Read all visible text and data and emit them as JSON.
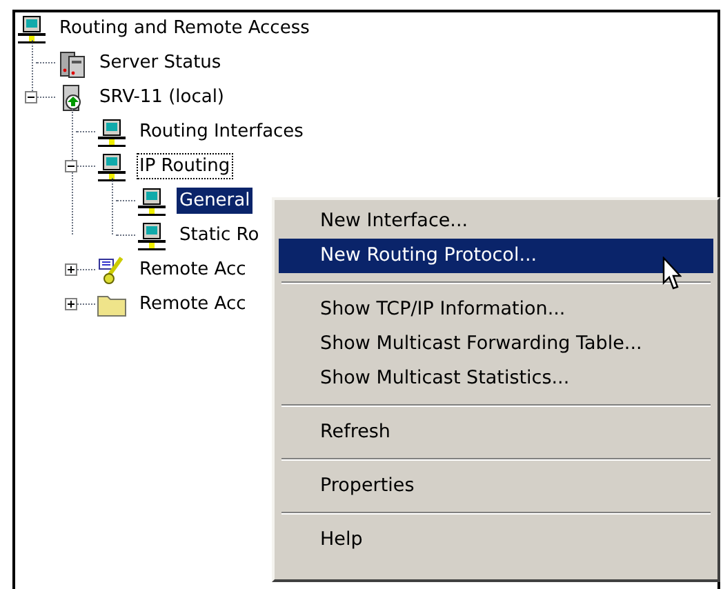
{
  "tree": [
    {
      "label": "Routing and Remote Access",
      "kind": "computer",
      "selected": false,
      "focused": false,
      "children": [
        {
          "label": "Server Status",
          "kind": "server",
          "selected": false,
          "focused": false
        },
        {
          "label": "SRV-11 (local)",
          "kind": "local-server",
          "expanded": true,
          "selected": false,
          "focused": false,
          "children": [
            {
              "label": "Routing Interfaces",
              "kind": "computer",
              "selected": false,
              "focused": false
            },
            {
              "label": "IP Routing",
              "kind": "computer",
              "expanded": true,
              "selected": false,
              "focused": true,
              "children": [
                {
                  "label": "General",
                  "kind": "computer",
                  "selected": true,
                  "focused": false
                },
                {
                  "label": "Static Ro",
                  "kind": "computer",
                  "selected": false,
                  "focused": false
                }
              ]
            },
            {
              "label": "Remote Acc",
              "kind": "policy",
              "expanded": false,
              "selected": false,
              "focused": false
            },
            {
              "label": "Remote Acc",
              "kind": "folder",
              "expanded": false,
              "selected": false,
              "focused": false
            }
          ]
        }
      ]
    }
  ],
  "context_menu": [
    {
      "kind": "item",
      "label": "New Interface...",
      "selected": false
    },
    {
      "kind": "item",
      "label": "New Routing Protocol...",
      "selected": true
    },
    {
      "kind": "separator"
    },
    {
      "kind": "item",
      "label": "Show TCP/IP Information...",
      "selected": false
    },
    {
      "kind": "item",
      "label": "Show Multicast Forwarding Table...",
      "selected": false
    },
    {
      "kind": "item",
      "label": "Show Multicast Statistics...",
      "selected": false
    },
    {
      "kind": "separator"
    },
    {
      "kind": "item",
      "label": "Refresh",
      "selected": false
    },
    {
      "kind": "separator"
    },
    {
      "kind": "item",
      "label": "Properties",
      "selected": false
    },
    {
      "kind": "separator"
    },
    {
      "kind": "item",
      "label": "Help",
      "selected": false
    }
  ]
}
